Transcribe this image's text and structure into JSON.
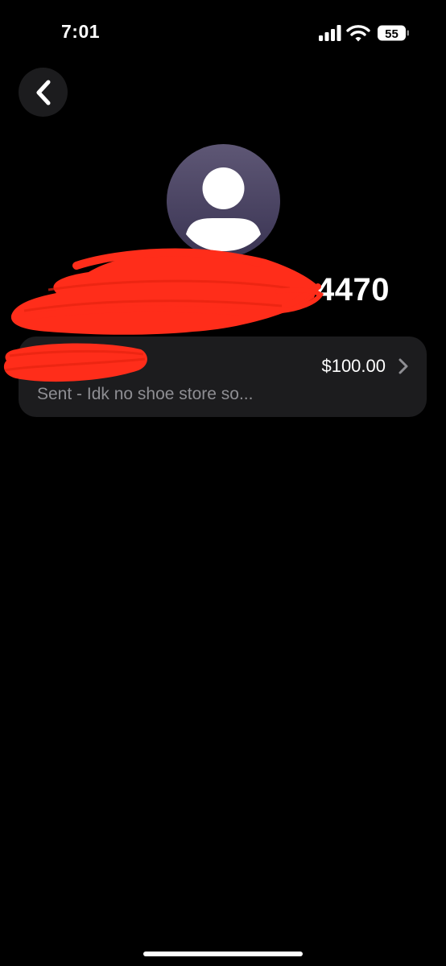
{
  "status_bar": {
    "time": "7:01",
    "battery_level": "55",
    "icons": [
      "cellular-signal-icon",
      "wifi-icon",
      "battery-icon"
    ]
  },
  "header": {
    "back_icon": "chevron-left-icon"
  },
  "contact": {
    "avatar_icon": "person-placeholder-icon",
    "name_visible": "4470"
  },
  "transaction": {
    "amount": "$100.00",
    "memo": "Sent - Idk no shoe store so...",
    "chevron_icon": "chevron-right-icon"
  },
  "colors": {
    "background": "#000000",
    "card": "#1c1c1e",
    "secondary_text": "#8e8e93",
    "avatar_top": "#5e5775",
    "avatar_bottom": "#3a3453",
    "redaction": "#ff2d1a"
  }
}
